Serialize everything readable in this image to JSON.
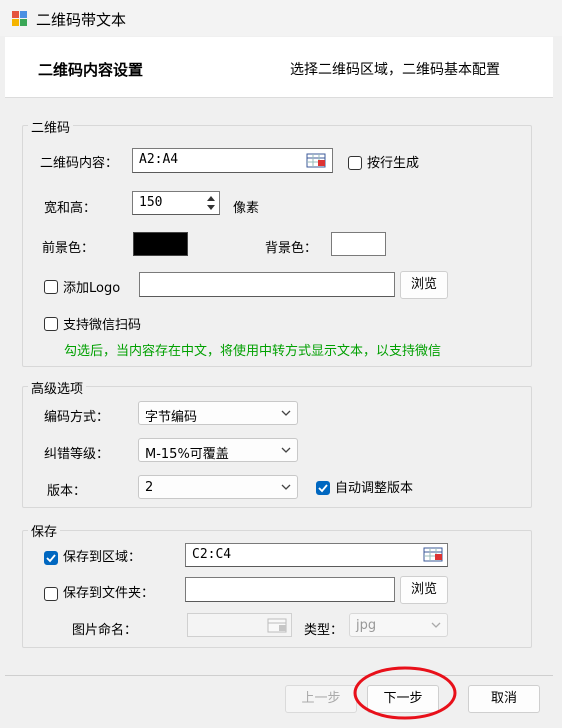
{
  "window": {
    "title": "二维码带文本"
  },
  "header": {
    "title": "二维码内容设置",
    "subtitle": "选择二维码区域，二维码基本配置"
  },
  "qr_group": {
    "label": "二维码",
    "content_label": "二维码内容：",
    "content_value": "A2:A4",
    "by_row_label": "按行生成",
    "by_row_checked": false,
    "size_label": "宽和高：",
    "size_value": "150",
    "size_unit": "像素",
    "fg_label": "前景色：",
    "fg_color": "#000000",
    "bg_label": "背景色：",
    "bg_color": "#ffffff",
    "logo_label": "添加Logo",
    "logo_checked": false,
    "logo_value": "",
    "browse_label": "浏览",
    "wechat_label": "支持微信扫码",
    "wechat_checked": false,
    "wechat_hint": "勾选后，当内容存在中文，将使用中转方式显示文本，以支持微信"
  },
  "advanced_group": {
    "label": "高级选项",
    "encoding_label": "编码方式：",
    "encoding_value": "字节编码",
    "ecc_label": "纠错等级：",
    "ecc_value": "M-15%可覆盖",
    "version_label": "版本：",
    "version_value": "2",
    "auto_version_label": "自动调整版本",
    "auto_version_checked": true
  },
  "save_group": {
    "label": "保存",
    "to_range_label": "保存到区域：",
    "to_range_checked": true,
    "range_value": "C2:C4",
    "to_folder_label": "保存到文件夹：",
    "to_folder_checked": false,
    "folder_value": "",
    "browse_label": "浏览",
    "image_name_label": "图片命名：",
    "image_name_value": "",
    "type_label": "类型：",
    "type_value": "jpg"
  },
  "footer": {
    "prev_label": "上一步",
    "next_label": "下一步",
    "cancel_label": "取消"
  },
  "colors": {
    "accent": "#0067c0",
    "hint": "#00a000",
    "highlight_ring": "#e8101a"
  }
}
